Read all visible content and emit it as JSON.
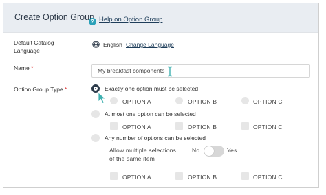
{
  "header": {
    "title": "Create Option Group",
    "help_link": "Help on Option Group"
  },
  "form": {
    "catalog_language": {
      "label_line1": "Default Catalog",
      "label_line2": "Language",
      "value": "English",
      "change_link": "Change Language"
    },
    "name": {
      "label": "Name",
      "required_mark": "*",
      "value": "My breakfast components"
    },
    "type": {
      "label": "Option Group Type",
      "required_mark": "*",
      "options": [
        {
          "label": "Exactly one option must be selected",
          "selected": true,
          "sub_labels": [
            "OPTION A",
            "OPTION B",
            "OPTION C"
          ]
        },
        {
          "label": "At most one option can be selected",
          "selected": false,
          "sub_labels": [
            "OPTION A",
            "OPTION B",
            "OPTION C"
          ]
        },
        {
          "label": "Any number of options can be selected",
          "selected": false,
          "sub_labels": [
            "OPTION A",
            "OPTION B",
            "OPTION C"
          ]
        }
      ],
      "multiple_selection": {
        "label_line1": "Allow multiple selections",
        "label_line2": "of the same item",
        "no_label": "No",
        "yes_label": "Yes",
        "enabled": false
      }
    }
  },
  "colors": {
    "header_bg": "#e9edf2",
    "link": "#1f3e5a",
    "accent": "#2aa0b8",
    "cursor": "#3fb0b0",
    "required": "#d33333"
  },
  "icons": {
    "help": "help-circle-icon",
    "language": "globe-icon",
    "text_cursor": "text-cursor-icon",
    "pointer": "mouse-pointer-icon"
  }
}
